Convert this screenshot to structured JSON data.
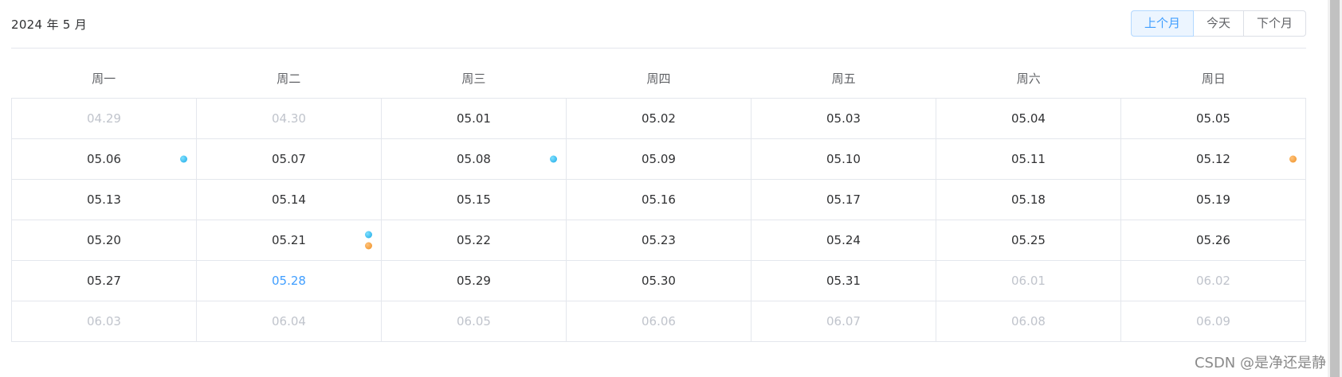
{
  "header": {
    "title": "2024 年 5 月",
    "buttons": {
      "prev": "上个月",
      "today": "今天",
      "next": "下个月"
    }
  },
  "weekdays": [
    "周一",
    "周二",
    "周三",
    "周四",
    "周五",
    "周六",
    "周日"
  ],
  "colors": {
    "accent": "#409eff",
    "dot_blue": "#1ba9e6",
    "dot_orange": "#ee8f23",
    "other_month_text": "#c0c4cc"
  },
  "weeks": [
    [
      {
        "date": "04.29",
        "other": true
      },
      {
        "date": "04.30",
        "other": true
      },
      {
        "date": "05.01"
      },
      {
        "date": "05.02"
      },
      {
        "date": "05.03"
      },
      {
        "date": "05.04"
      },
      {
        "date": "05.05"
      }
    ],
    [
      {
        "date": "05.06",
        "dots": [
          "blue"
        ]
      },
      {
        "date": "05.07"
      },
      {
        "date": "05.08",
        "dots": [
          "blue"
        ]
      },
      {
        "date": "05.09"
      },
      {
        "date": "05.10"
      },
      {
        "date": "05.11"
      },
      {
        "date": "05.12",
        "dots": [
          "orange"
        ]
      }
    ],
    [
      {
        "date": "05.13"
      },
      {
        "date": "05.14"
      },
      {
        "date": "05.15"
      },
      {
        "date": "05.16"
      },
      {
        "date": "05.17"
      },
      {
        "date": "05.18"
      },
      {
        "date": "05.19"
      }
    ],
    [
      {
        "date": "05.20"
      },
      {
        "date": "05.21",
        "dots": [
          "blue",
          "orange"
        ]
      },
      {
        "date": "05.22"
      },
      {
        "date": "05.23"
      },
      {
        "date": "05.24"
      },
      {
        "date": "05.25"
      },
      {
        "date": "05.26"
      }
    ],
    [
      {
        "date": "05.27"
      },
      {
        "date": "05.28",
        "today": true
      },
      {
        "date": "05.29"
      },
      {
        "date": "05.30"
      },
      {
        "date": "05.31"
      },
      {
        "date": "06.01",
        "other": true
      },
      {
        "date": "06.02",
        "other": true
      }
    ],
    [
      {
        "date": "06.03",
        "other": true
      },
      {
        "date": "06.04",
        "other": true
      },
      {
        "date": "06.05",
        "other": true
      },
      {
        "date": "06.06",
        "other": true
      },
      {
        "date": "06.07",
        "other": true
      },
      {
        "date": "06.08",
        "other": true
      },
      {
        "date": "06.09",
        "other": true
      }
    ]
  ],
  "watermark": "CSDN @是净还是静"
}
